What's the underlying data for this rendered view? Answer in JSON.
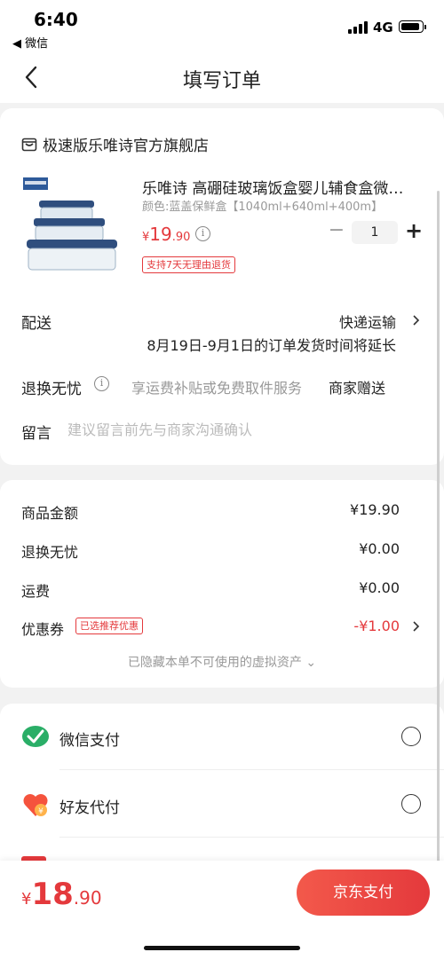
{
  "status_bar": {
    "time": "6:40",
    "back_app": "◀ 微信",
    "network": "4G"
  },
  "nav": {
    "title": "填写订单"
  },
  "store": {
    "name": "极速版乐唯诗官方旗舰店"
  },
  "product": {
    "title": "乐唯诗 高硼硅玻璃饭盒婴儿辅食盒微…",
    "spec": "颜色:蓝盖保鲜盒【1040ml+640ml+400m】",
    "price_symbol": "¥",
    "price_int": "19",
    "price_dec": ".90",
    "quantity": "1",
    "badge": "支持7天无理由退货"
  },
  "delivery": {
    "label": "配送",
    "method": "快递运输",
    "note": "8月19日-9月1日的订单发货时间将延长"
  },
  "service": {
    "label": "退换无忧",
    "desc": "享运费补贴或免费取件服务",
    "value": "商家赠送"
  },
  "message": {
    "label": "留言",
    "placeholder": "建议留言前先与商家沟通确认"
  },
  "summary": {
    "goods_label": "商品金额",
    "goods_value": "¥19.90",
    "service_label": "退换无忧",
    "service_value": "¥0.00",
    "shipping_label": "运费",
    "shipping_value": "¥0.00",
    "coupon_label": "优惠券",
    "coupon_tag": "已选推荐优惠",
    "coupon_value": "-¥1.00",
    "hidden_note": "已隐藏本单不可使用的虚拟资产 ⌄"
  },
  "payment": {
    "options": [
      {
        "label": "微信支付",
        "icon": "wechat-pay-icon",
        "selected": false
      },
      {
        "label": "好友代付",
        "icon": "friend-pay-icon",
        "selected": false
      }
    ]
  },
  "bottom": {
    "total_symbol": "¥",
    "total_int": "18",
    "total_dec": ".90",
    "pay_button": "京东支付"
  },
  "colors": {
    "accent": "#e4393c",
    "wechat_green": "#2aae67",
    "background": "#f2f2f2"
  }
}
